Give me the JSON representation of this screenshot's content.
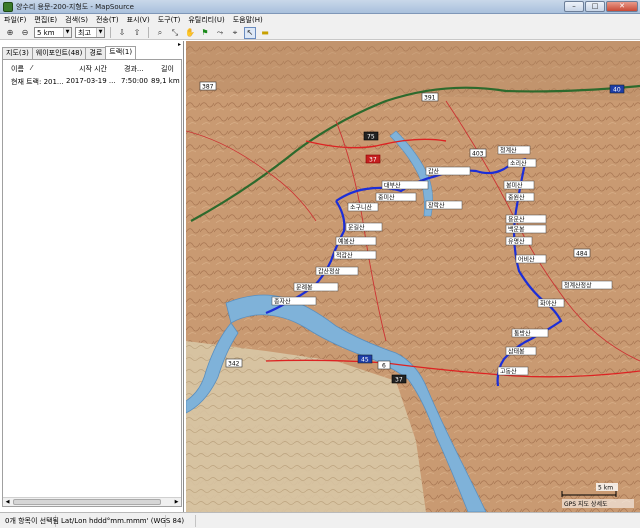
{
  "window": {
    "title": "양수리 용문-200-지형도 - MapSource"
  },
  "menu": [
    "파일(F)",
    "편집(E)",
    "검색(S)",
    "전송(T)",
    "표시(V)",
    "도구(T)",
    "유틸리티(U)",
    "도움말(H)"
  ],
  "toolbar": {
    "zoom_value": "5 km",
    "detail_value": "최고"
  },
  "tabs": [
    "지도(3)",
    "웨이포인트(48)",
    "경로",
    "트랙(1)"
  ],
  "track_list": {
    "headers": {
      "name": "이름",
      "start_time": "시작 시간",
      "elapsed": "경과...",
      "length": "길이"
    },
    "rows": [
      {
        "name": "현재 트랙: 201...",
        "start_time": "2017-03-19 ...",
        "elapsed": "7:50:00",
        "length": "89,1 km"
      }
    ]
  },
  "map": {
    "highway_labels": [
      "387",
      "391",
      "75",
      "37",
      "403",
      "40",
      "484",
      "342",
      "45",
      "6",
      "37"
    ],
    "waypoint_labels": [
      "청계산",
      "소리산",
      "봉미산",
      "중원산",
      "용문산",
      "백운봉",
      "유명산",
      "어비산",
      "청계산정상",
      "화야산",
      "통방산",
      "삼태봉",
      "고동산",
      "갑산",
      "대부산",
      "중미산",
      "소구니산",
      "장락산",
      "운길산",
      "예봉산",
      "적갑산",
      "갑산정상",
      "문례봉",
      "종자산"
    ],
    "scale_label": "5 km",
    "copyright": "GPS 지도 상세도"
  },
  "status": {
    "selection": "0개 항목이 선택됨",
    "coords": "Lat/Lon hddd°mm.mmm' (WGS 84)"
  }
}
